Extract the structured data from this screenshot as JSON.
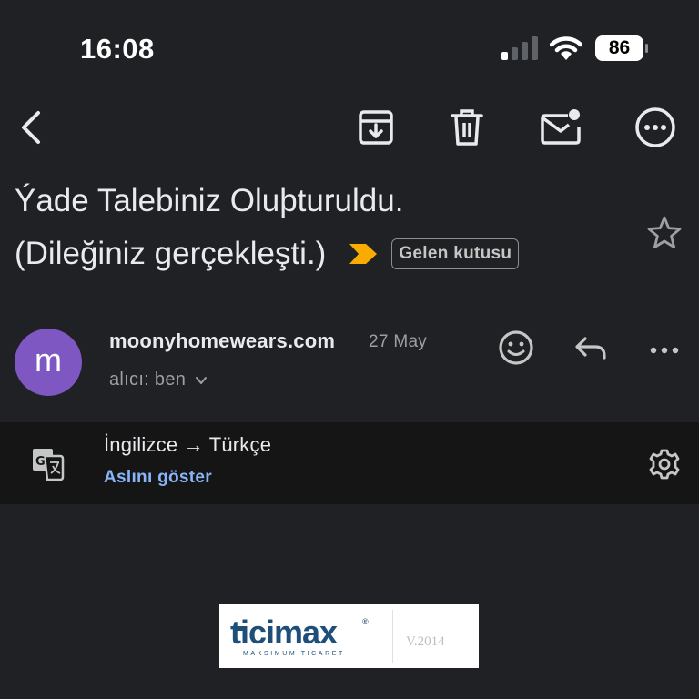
{
  "status_bar": {
    "time": "16:08",
    "battery": "86",
    "icons": [
      "cellular-signal-icon",
      "wifi-icon",
      "battery-icon"
    ]
  },
  "toolbar": {
    "icons": [
      "back-arrow-icon",
      "archive-icon",
      "trash-icon",
      "mark-unread-icon",
      "more-options-icon"
    ]
  },
  "email": {
    "subject_line1": "Ýade Talebiniz Oluþturuldu.",
    "subject_line2": "(Dileğiniz gerçekleşti.)",
    "label": "Gelen kutusu",
    "sender": "moonyhomewears.com",
    "date": "27 May",
    "recipient": "alıcı: ben",
    "avatar_letter": "m",
    "avatar_color": "#7e57c2",
    "importance_color": "#f9ab00"
  },
  "translate": {
    "languages": "İngilizce → Türkçe",
    "show_original": "Aslını göster"
  },
  "logo": {
    "brand": "ticimax",
    "tagline": "MAKSIMUM TICARET",
    "version": "V.2014",
    "brand_color": "#1e4f7a"
  }
}
